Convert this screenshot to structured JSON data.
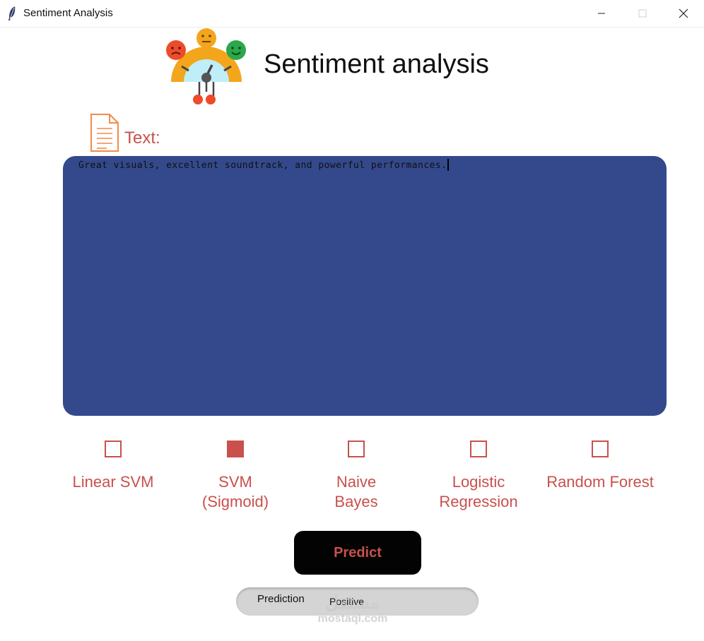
{
  "window": {
    "title": "Sentiment Analysis",
    "controls": {
      "minimize": "minimize-icon",
      "maximize": "maximize-icon",
      "close": "close-icon"
    }
  },
  "header": {
    "title": "Sentiment analysis",
    "logo_icon": "sentiment-meter-icon"
  },
  "input": {
    "label": "Text:",
    "label_icon": "document-icon",
    "value": "Great visuals, excellent soundtrack, and powerful performances."
  },
  "models": [
    {
      "label": "Linear SVM",
      "checked": false
    },
    {
      "label": "SVM\n(Sigmoid)",
      "checked": true
    },
    {
      "label": "Naive\nBayes",
      "checked": false
    },
    {
      "label": "Logistic\nRegression",
      "checked": false
    },
    {
      "label": "Random Forest",
      "checked": false
    }
  ],
  "predict_button": {
    "label": "Predict"
  },
  "result": {
    "key_label": "Prediction",
    "value": "Positive"
  },
  "watermark": {
    "arabic": "مستقل",
    "english": "mostaql.com"
  },
  "colors": {
    "accent": "#c9504c",
    "textarea_bg": "#34498c",
    "button_bg": "#030303",
    "result_bg": "#d4d4d4"
  }
}
